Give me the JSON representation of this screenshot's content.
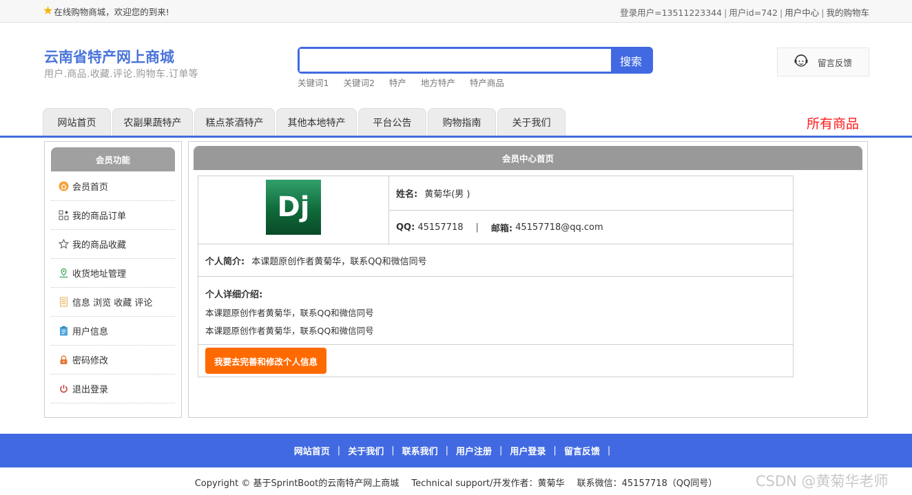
{
  "topbar": {
    "welcome": "在线购物商城，欢迎您的到来!",
    "user_login": "登录用户=13511223344",
    "user_id": "用户id=742",
    "user_center": "用户中心",
    "cart": "我的购物车",
    "separator": "|"
  },
  "brand": {
    "title": "云南省特产网上商城",
    "subtitle": "用户.商品.收藏.评论.购物车.订单等"
  },
  "search": {
    "value": "",
    "placeholder": "",
    "button": "搜索",
    "keywords": [
      "关键词1",
      "关键词2",
      "特产",
      "地方特产",
      "特产商品"
    ]
  },
  "feedback": {
    "label": "留言反馈"
  },
  "nav": {
    "tabs": [
      "网站首页",
      "农副果蔬特产",
      "糕点茶酒特产",
      "其他本地特产",
      "平台公告",
      "购物指南",
      "关于我们"
    ],
    "all_products": "所有商品",
    "accent": "#4169e1"
  },
  "sidebar": {
    "title": "会员功能",
    "items": [
      {
        "label": "会员首页",
        "icon": "home-icon"
      },
      {
        "label": "我的商品订单",
        "icon": "grid-icon"
      },
      {
        "label": "我的商品收藏",
        "icon": "star-icon"
      },
      {
        "label": "收货地址管理",
        "icon": "location-icon"
      },
      {
        "label": "信息 浏览 收藏 评论",
        "icon": "document-icon"
      },
      {
        "label": "用户信息",
        "icon": "clipboard-icon"
      },
      {
        "label": "密码修改",
        "icon": "lock-icon"
      },
      {
        "label": "退出登录",
        "icon": "power-icon"
      }
    ]
  },
  "main": {
    "title": "会员中心首页",
    "avatar_text": "Dj",
    "name_label": "姓名:",
    "name_value": "黄菊华(男 )",
    "qq_label": "QQ:",
    "qq_value": "45157718",
    "contact_sep": "|",
    "email_label": "邮箱:",
    "email_value": "45157718@qq.com",
    "intro_label": "个人简介:",
    "intro_value": "本课题原创作者黄菊华，联系QQ和微信同号",
    "detail_label": "个人详细介绍:",
    "detail_lines": [
      "本课题原创作者黄菊华，联系QQ和微信同号",
      "本课题原创作者黄菊华，联系QQ和微信同号"
    ],
    "edit_button": "我要去完善和修改个人信息",
    "button_color": "#ff6a00"
  },
  "footer": {
    "links": [
      "网站首页",
      "关于我们",
      "联系我们",
      "用户注册",
      "用户登录",
      "留言反馈"
    ],
    "separator": "|",
    "copyright": "Copyright © 基于SprintBoot的云南特产网上商城",
    "support": "Technical support/开发作者：黄菊华",
    "wechat": "联系微信：45157718（QQ同号）",
    "watermark": "CSDN @黄菊华老师"
  }
}
